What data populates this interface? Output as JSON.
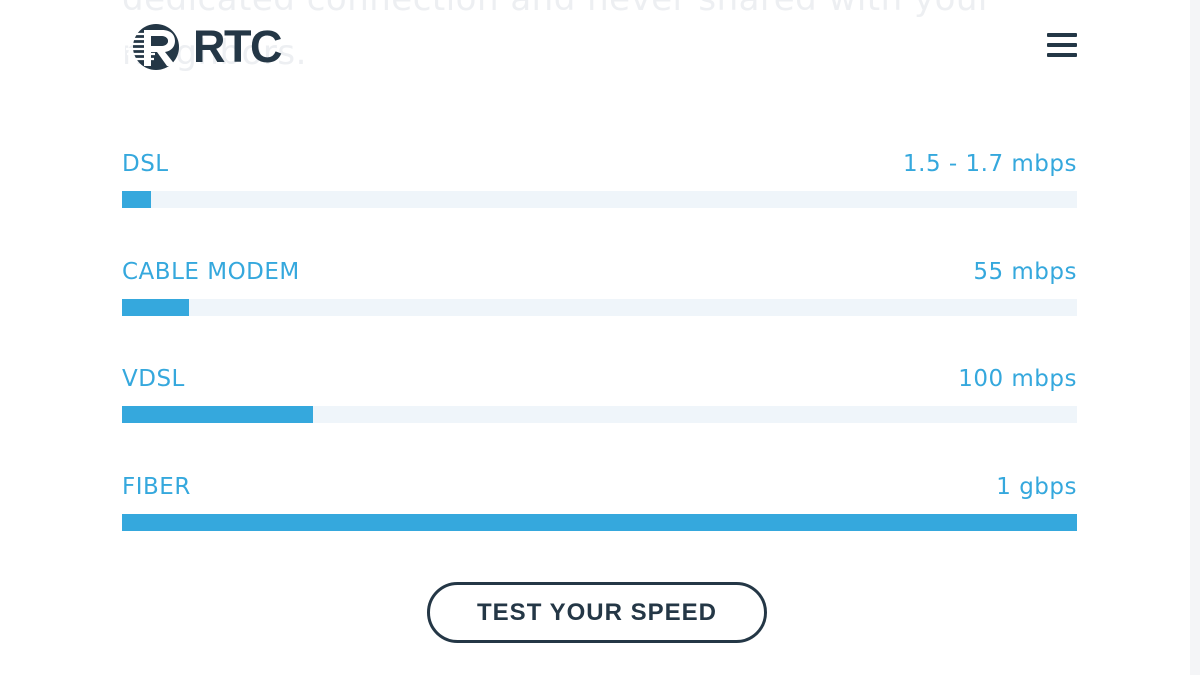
{
  "background_text": "dedicated connection and never shared with your neighbors.",
  "header": {
    "logo_text": "RTC",
    "menu_icon": "hamburger-menu-icon"
  },
  "speeds": [
    {
      "label": "DSL",
      "value": "1.5 - 1.7 mbps",
      "fill_fraction": 0.03
    },
    {
      "label": "CABLE MODEM",
      "value": "55 mbps",
      "fill_fraction": 0.07
    },
    {
      "label": "VDSL",
      "value": "100 mbps",
      "fill_fraction": 0.2
    },
    {
      "label": "FIBER",
      "value": "1 gbps",
      "fill_fraction": 1.0
    }
  ],
  "cta": {
    "label": "TEST YOUR SPEED"
  },
  "colors": {
    "accent": "#35a8dd",
    "track": "#eff5fa",
    "brand_dark": "#243746"
  }
}
